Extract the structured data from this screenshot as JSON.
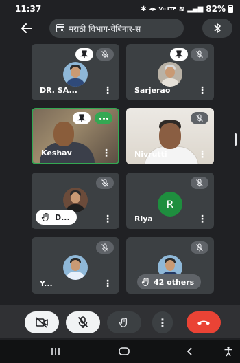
{
  "status": {
    "time": "11:37",
    "signal_text": "Vo LTE",
    "battery": "82%"
  },
  "header": {
    "title": "मराठी विभाग-वेबिनार-स"
  },
  "participants": [
    {
      "name": "DR. SA...",
      "pinned": true,
      "muted": true
    },
    {
      "name": "Sarjerao",
      "pinned": true,
      "muted": true
    },
    {
      "name": "Keshav",
      "pinned": true,
      "speaking": true
    },
    {
      "name": "Nivrutti",
      "muted": true
    },
    {
      "name": "D...",
      "muted": true,
      "hand_raised": true
    },
    {
      "name": "Riya",
      "muted": true,
      "avatar_letter": "R"
    },
    {
      "name": "Y...",
      "muted": true
    },
    {
      "others_label": "42 others",
      "muted": true,
      "hand_raised": true
    }
  ],
  "colors": {
    "background": "#202124",
    "tile": "#3c4043",
    "speaking": "#34a853",
    "end_call": "#ea4335",
    "letter_avatar": "#1e8e3e"
  },
  "icons": {
    "mute": "mic-off-icon",
    "pin": "pin-icon",
    "hand": "hand-icon",
    "more": "more-vert-icon"
  }
}
